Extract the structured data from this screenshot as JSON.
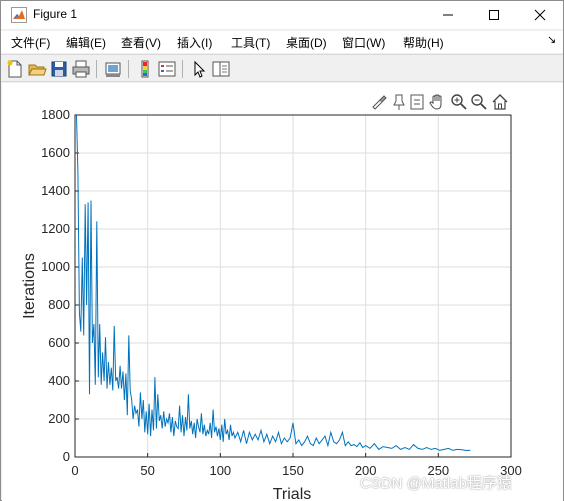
{
  "window": {
    "title": "Figure 1",
    "controls": {
      "minimize": "minimize",
      "maximize": "maximize",
      "close": "close"
    }
  },
  "menu": {
    "items": [
      "编辑(E)",
      "查看(V)",
      "插入(I)",
      "工具(T)",
      "桌面(D)",
      "窗口(W)",
      "帮助(H)"
    ],
    "file": "文件(F)",
    "dock": "↘"
  },
  "toolbar": {
    "buttons": [
      "new-figure-icon",
      "open-file-icon",
      "save-icon",
      "print-icon",
      "link-plot-icon",
      "insert-colorbar-icon",
      "insert-legend-icon",
      "edit-plot-pointer-icon",
      "property-inspector-icon"
    ]
  },
  "axes_toolbar": {
    "buttons": [
      "brush-icon",
      "data-tips-icon",
      "export-icon",
      "pan-hand-icon",
      "zoom-in-icon",
      "zoom-out-icon",
      "home-icon"
    ]
  },
  "chart_data": {
    "type": "line",
    "xlabel": "Trials",
    "ylabel": "Iterations",
    "xlim": [
      0,
      300
    ],
    "ylim": [
      0,
      1800
    ],
    "xticks": [
      0,
      50,
      100,
      150,
      200,
      250,
      300
    ],
    "yticks": [
      0,
      200,
      400,
      600,
      800,
      1000,
      1200,
      1400,
      1600,
      1800
    ],
    "grid": true,
    "color": "#0072bd",
    "x": [
      1,
      2,
      3,
      4,
      5,
      6,
      7,
      8,
      9,
      10,
      11,
      12,
      13,
      14,
      15,
      16,
      17,
      18,
      19,
      20,
      21,
      22,
      23,
      24,
      25,
      26,
      27,
      28,
      29,
      30,
      31,
      32,
      33,
      34,
      35,
      36,
      37,
      38,
      39,
      40,
      41,
      42,
      43,
      44,
      45,
      46,
      47,
      48,
      49,
      50,
      51,
      52,
      53,
      54,
      55,
      56,
      57,
      58,
      59,
      60,
      61,
      62,
      63,
      64,
      65,
      66,
      67,
      68,
      69,
      70,
      71,
      72,
      73,
      74,
      75,
      76,
      77,
      78,
      79,
      80,
      81,
      82,
      83,
      84,
      85,
      86,
      87,
      88,
      89,
      90,
      91,
      92,
      93,
      94,
      95,
      96,
      97,
      98,
      99,
      100,
      101,
      102,
      103,
      104,
      105,
      106,
      107,
      108,
      109,
      110,
      112,
      114,
      116,
      118,
      120,
      122,
      124,
      126,
      128,
      130,
      132,
      134,
      136,
      138,
      140,
      142,
      144,
      146,
      148,
      150,
      152,
      154,
      156,
      158,
      160,
      162,
      164,
      166,
      168,
      170,
      172,
      174,
      176,
      178,
      180,
      182,
      184,
      186,
      188,
      190,
      192,
      194,
      196,
      198,
      200,
      203,
      206,
      209,
      212,
      215,
      218,
      221,
      224,
      227,
      230,
      233,
      236,
      239,
      242,
      245,
      248,
      251,
      254,
      257,
      260,
      263,
      266,
      269,
      272,
      275,
      278,
      281,
      284,
      287,
      290
    ],
    "y": [
      1800,
      1500,
      760,
      660,
      1050,
      640,
      1330,
      800,
      1340,
      330,
      1350,
      600,
      700,
      380,
      1240,
      420,
      700,
      380,
      550,
      400,
      630,
      360,
      500,
      380,
      470,
      350,
      690,
      400,
      420,
      360,
      480,
      360,
      450,
      300,
      440,
      220,
      640,
      350,
      300,
      200,
      270,
      230,
      250,
      160,
      340,
      200,
      300,
      130,
      240,
      120,
      280,
      110,
      250,
      140,
      420,
      150,
      330,
      190,
      220,
      150,
      240,
      160,
      200,
      180,
      230,
      130,
      210,
      110,
      190,
      160,
      150,
      270,
      130,
      220,
      110,
      210,
      140,
      330,
      150,
      190,
      120,
      180,
      100,
      200,
      160,
      130,
      230,
      120,
      170,
      110,
      140,
      120,
      180,
      100,
      250,
      130,
      160,
      110,
      150,
      90,
      170,
      80,
      200,
      120,
      140,
      90,
      170,
      110,
      130,
      100,
      130,
      80,
      140,
      70,
      130,
      90,
      120,
      90,
      140,
      80,
      120,
      70,
      110,
      80,
      130,
      70,
      100,
      80,
      100,
      180,
      70,
      90,
      60,
      80,
      110,
      70,
      60,
      100,
      70,
      90,
      110,
      60,
      130,
      80,
      70,
      90,
      130,
      60,
      80,
      60,
      65,
      55,
      75,
      50,
      60,
      45,
      70,
      40,
      55,
      50,
      45,
      60,
      40,
      50,
      40,
      65,
      45,
      40,
      50,
      40,
      45,
      35,
      40,
      45,
      35,
      40,
      38,
      35,
      35
    ]
  },
  "watermark": "CSDN @Matlab程序猿"
}
